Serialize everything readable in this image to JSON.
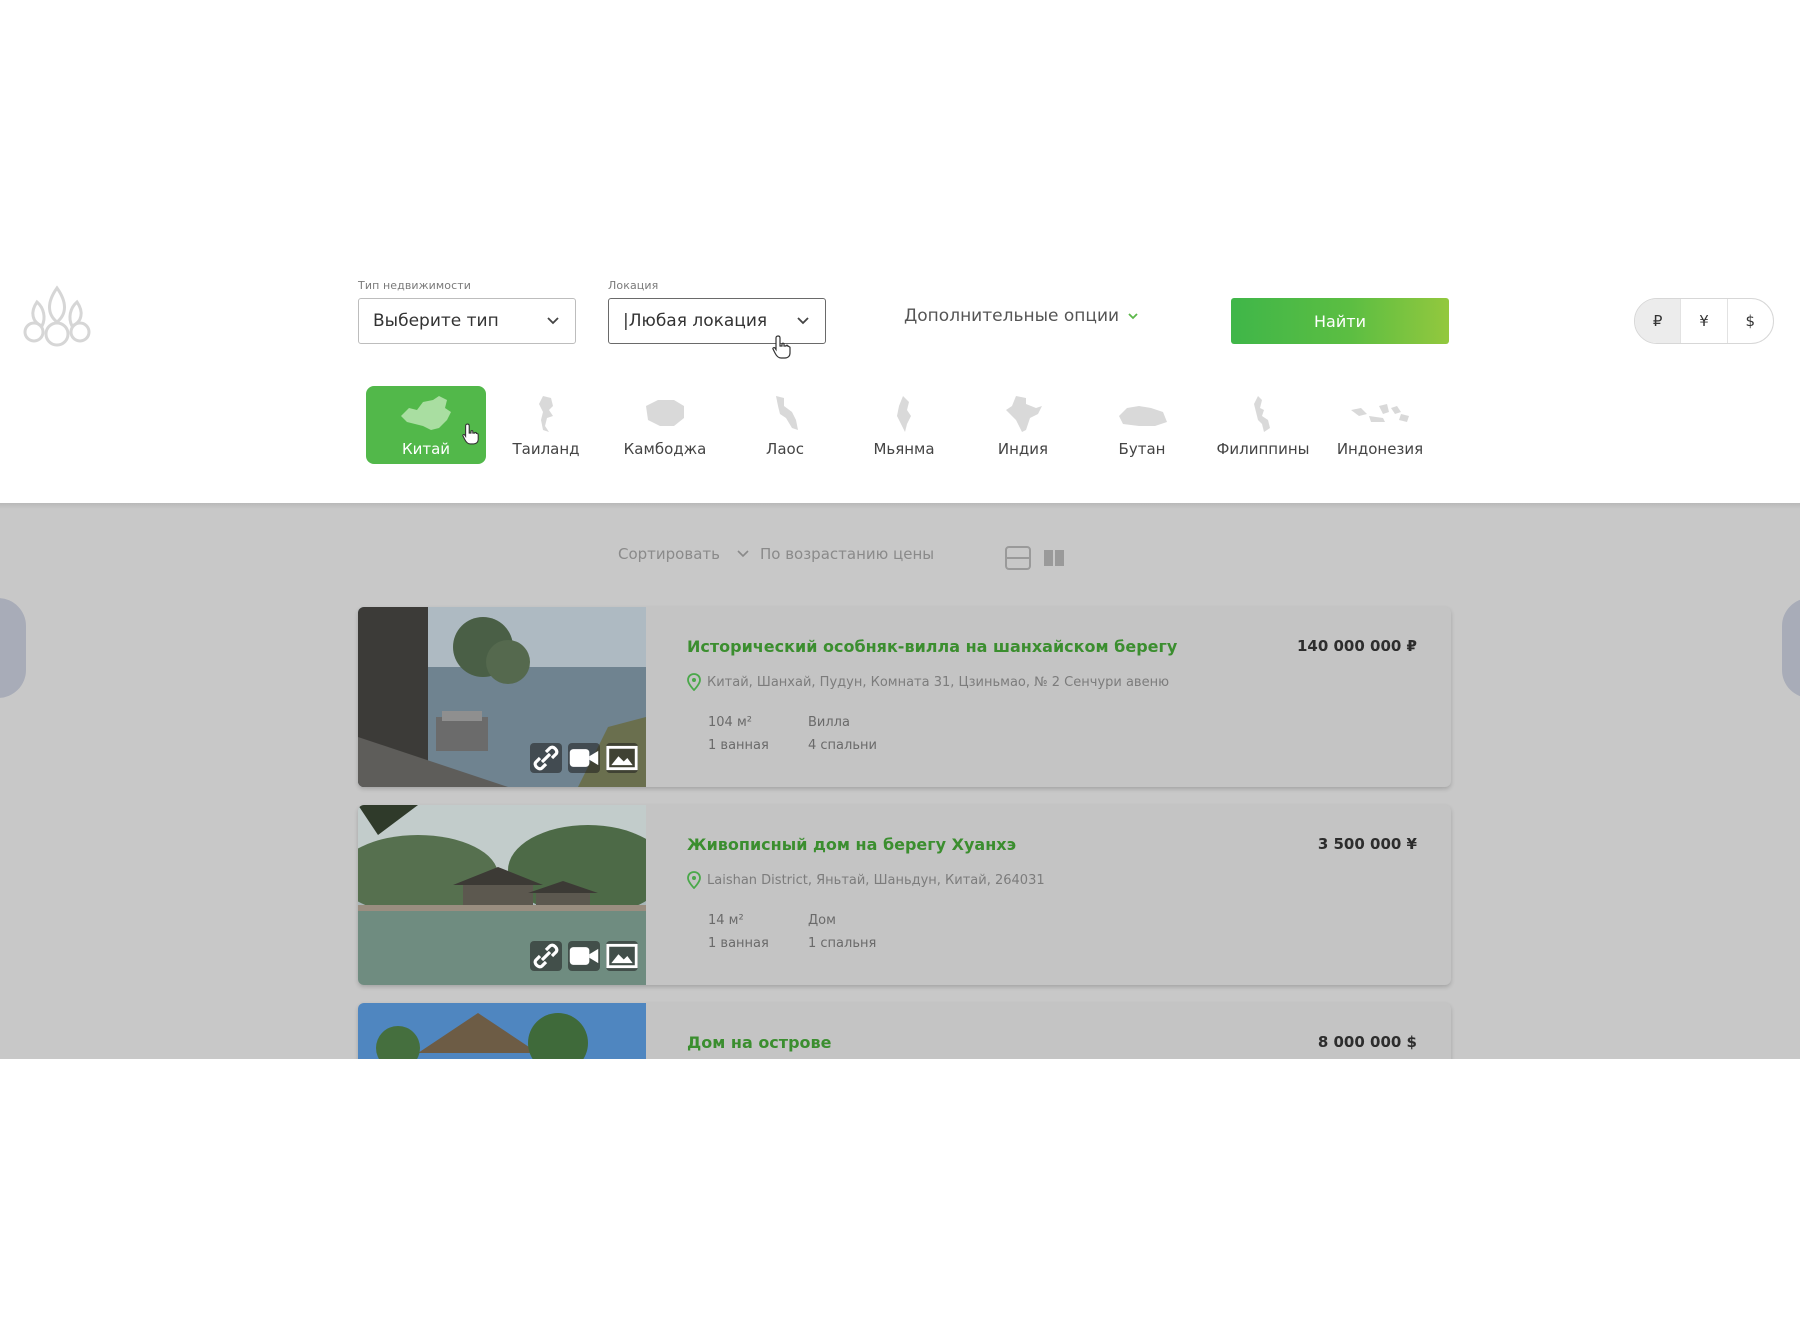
{
  "search": {
    "type_label": "Тип недвижимости",
    "type_value": "Выберите тип",
    "location_label": "Локация",
    "location_value": "|Любая локация",
    "more_options": "Дополнительные опции",
    "find_button": "Найти"
  },
  "currencies": [
    "₽",
    "¥",
    "$"
  ],
  "countries": [
    "Китай",
    "Таиланд",
    "Камбоджа",
    "Лаос",
    "Мьянма",
    "Индия",
    "Бутан",
    "Филиппины",
    "Индонезия"
  ],
  "sort": {
    "label": "Сортировать",
    "value": "По возрастанию цены"
  },
  "listings": [
    {
      "title": "Исторический особняк-вилла на шанхайском берегу",
      "price": "140 000 000 ₽",
      "address": "Китай, Шанхай, Пудун, Комната 31, Цзиньмао, № 2 Сенчури авеню",
      "area": "104 м²",
      "type": "Вилла",
      "baths": "1 ванная",
      "bedrooms": "4 спальни"
    },
    {
      "title": "Живописный дом на берегу Хуанхэ",
      "price": "3 500 000 ¥",
      "address": "Laishan District, Яньтай, Шаньдун, Китай, 264031",
      "area": "14 м²",
      "type": "Дом",
      "baths": "1 ванная",
      "bedrooms": "1 спальня"
    },
    {
      "title": "Дом на острове",
      "price": "8 000 000 $"
    }
  ],
  "colors": {
    "accent": "#52b84a",
    "title_green": "#3b8e2f",
    "overlay": "#c8c8c8"
  }
}
